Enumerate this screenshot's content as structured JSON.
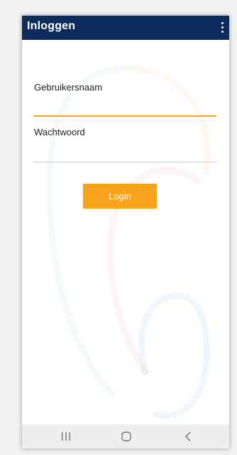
{
  "appbar": {
    "title": "Inloggen",
    "menu_icon": "more-vert-icon"
  },
  "form": {
    "username_label": "Gebruikersnaam",
    "username_value": "",
    "password_label": "Wachtwoord",
    "password_value": "",
    "login_label": "Login"
  },
  "navbar": {
    "recents_icon": "recents-icon",
    "home_icon": "home-icon",
    "back_icon": "back-icon"
  },
  "colors": {
    "appbar": "#0d2c5b",
    "accent": "#f7a21b",
    "focused_underline": "#f7a21b",
    "underline": "#cfcfcf"
  }
}
